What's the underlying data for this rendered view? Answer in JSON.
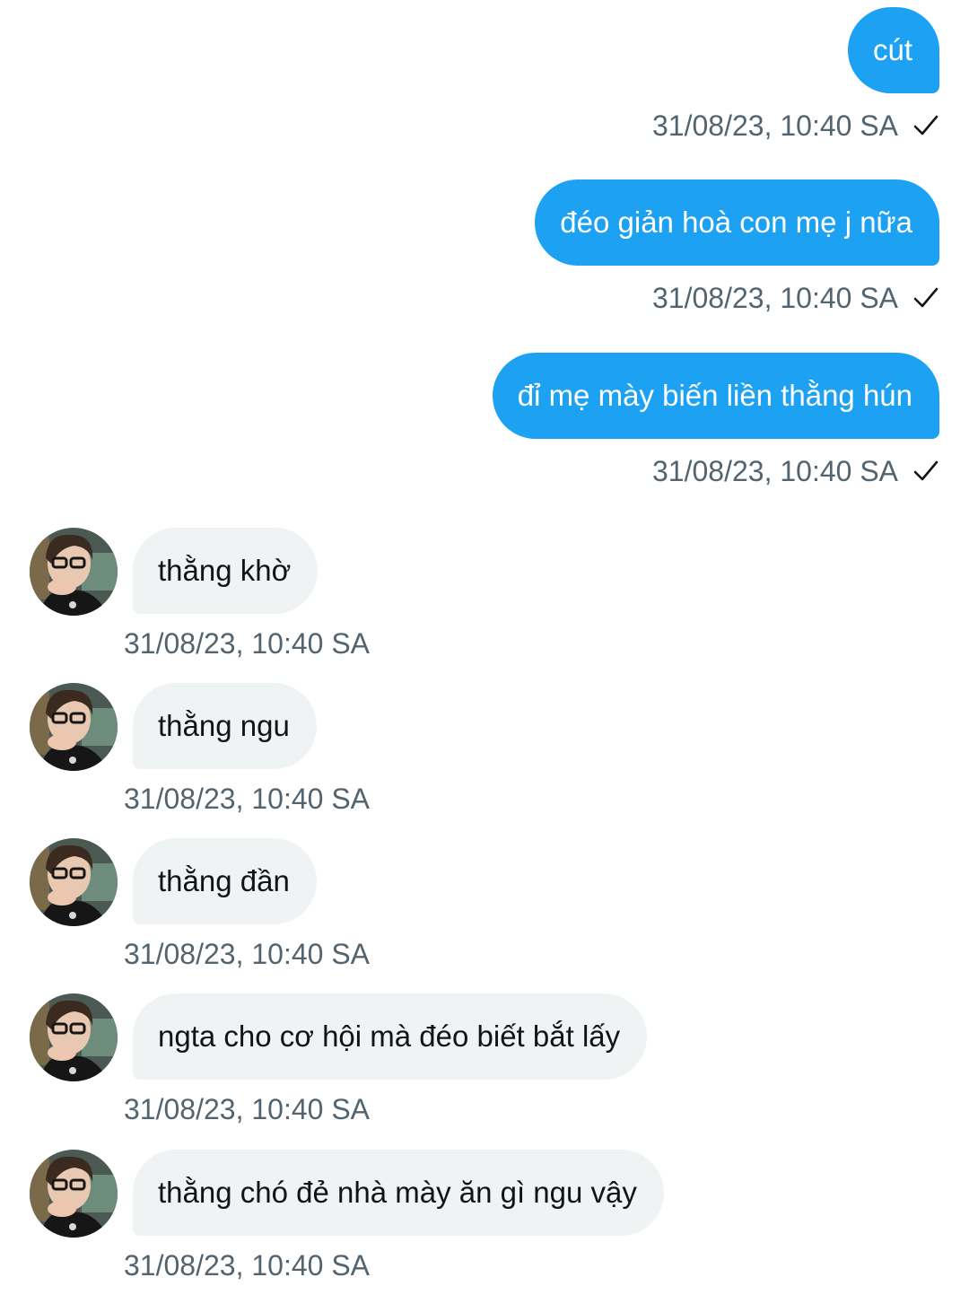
{
  "sent_messages": [
    {
      "text": "cút",
      "timestamp": "31/08/23, 10:40 SA",
      "status_icon": "check-icon"
    },
    {
      "text": "đéo giản hoà con mẹ j nữa",
      "timestamp": "31/08/23, 10:40 SA",
      "status_icon": "check-icon"
    },
    {
      "text": "đỉ mẹ mày biến liền thằng hún",
      "timestamp": "31/08/23, 10:40 SA",
      "status_icon": "check-icon"
    }
  ],
  "received_messages": [
    {
      "text": "thằng khờ",
      "timestamp": "31/08/23, 10:40 SA",
      "avatar": "user-avatar"
    },
    {
      "text": "thằng ngu",
      "timestamp": "31/08/23, 10:40 SA",
      "avatar": "user-avatar"
    },
    {
      "text": "thằng đần",
      "timestamp": "31/08/23, 10:40 SA",
      "avatar": "user-avatar"
    },
    {
      "text": "ngta cho cơ hội mà đéo biết bắt lấy",
      "timestamp": "31/08/23, 10:40 SA",
      "avatar": "user-avatar"
    },
    {
      "text": "thằng chó đẻ nhà mày ăn gì ngu vậy",
      "timestamp": "31/08/23, 10:40 SA",
      "avatar": "user-avatar"
    }
  ],
  "colors": {
    "sent_bubble": "#1da1f2",
    "received_bubble": "#eff3f4",
    "timestamp_text": "#536471",
    "received_text": "#0f1419"
  }
}
